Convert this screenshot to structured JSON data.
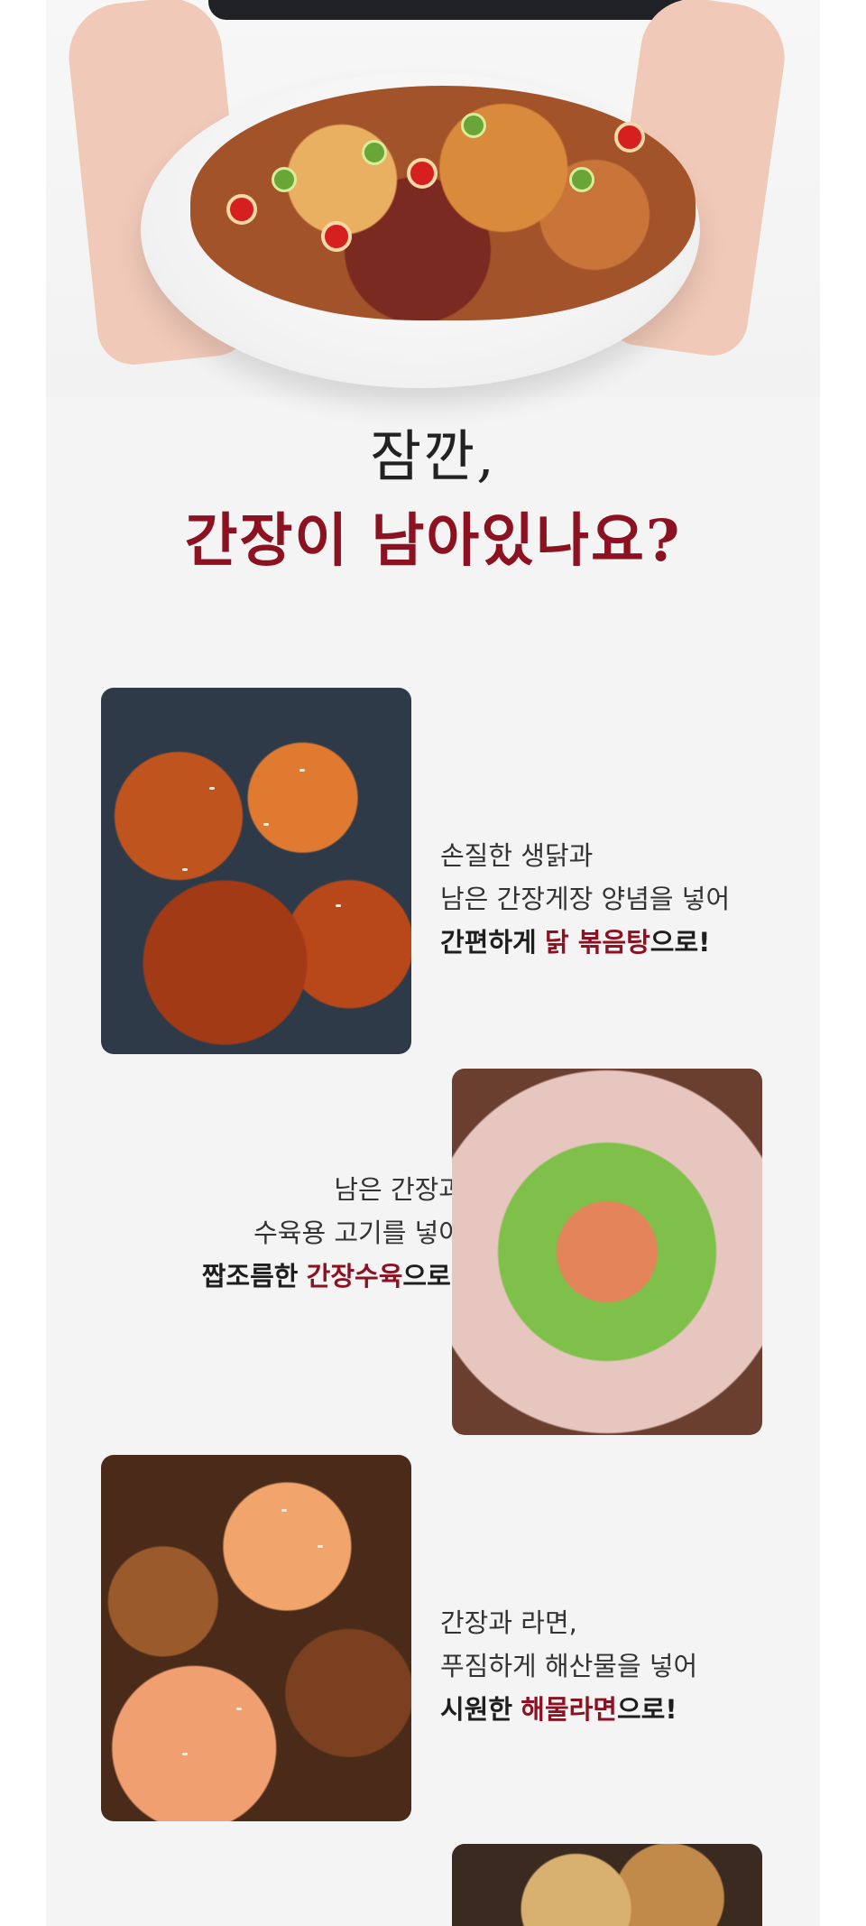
{
  "hero": {
    "image_alt": "hands holding a white bowl of soy-sauce marinated crab topped with chili and green onion"
  },
  "headline": {
    "line1": "잠깐,",
    "line2": "간장이 남아있나요?"
  },
  "recipes": [
    {
      "line1": "손질한 생닭과",
      "line2": "남은 간장게장 양념을 넣어",
      "line3_prefix": "간편하게",
      "line3_accent": "닭 볶음탕",
      "line3_suffix": "으로!"
    },
    {
      "line1": "남은 간장과",
      "line2": "수육용 고기를 넣어",
      "line3_prefix": "짭조름한",
      "line3_accent": "간장수육",
      "line3_suffix": "으로!"
    },
    {
      "line1": "간장과 라면,",
      "line2": "푸짐하게 해산물을 넣어",
      "line3_prefix": "시원한",
      "line3_accent": "해물라면",
      "line3_suffix": "으로!"
    }
  ],
  "colors": {
    "accent": "#8d1221",
    "text": "#333333",
    "background": "#f4f4f4"
  }
}
